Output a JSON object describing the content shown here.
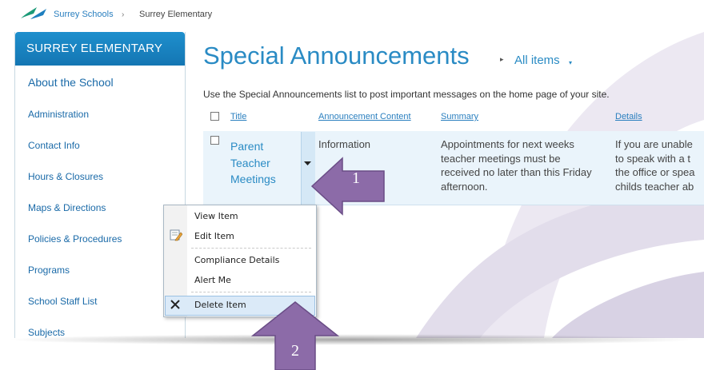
{
  "breadcrumb": {
    "site": "Surrey Schools",
    "separator": "›",
    "current": "Surrey Elementary"
  },
  "sidebar": {
    "heading": "SURREY ELEMENTARY",
    "top_link": "About the School",
    "items": [
      {
        "label": "Administration"
      },
      {
        "label": "Contact Info"
      },
      {
        "label": "Hours & Closures"
      },
      {
        "label": "Maps & Directions"
      },
      {
        "label": "Policies & Procedures"
      },
      {
        "label": "Programs"
      },
      {
        "label": "School Staff List"
      },
      {
        "label": "Subjects"
      }
    ]
  },
  "list": {
    "title": "Special Announcements",
    "view_arrow": "▸",
    "view": "All items",
    "view_caret": "▾",
    "description": "Use the Special Announcements list to post important messages on the home page of your site.",
    "columns": [
      "Title",
      "Announcement Content",
      "Summary",
      "Details"
    ],
    "row": {
      "title": "Parent Teacher Meetings",
      "content": "Information",
      "summary": "Appointments for next weeks teacher meetings must be received no later than this Friday afternoon.",
      "details": "If you are unable to speak with a t the office or spea childs teacher ab"
    }
  },
  "context_menu": {
    "items": [
      "View Item",
      "Edit Item",
      "Compliance Details",
      "Alert Me",
      "Delete Item"
    ]
  },
  "callouts": [
    "1",
    "2"
  ],
  "colors": {
    "accent": "#2a8bc4",
    "sidebar_header": "#1a82c2",
    "callout": "#8c6ba8"
  }
}
